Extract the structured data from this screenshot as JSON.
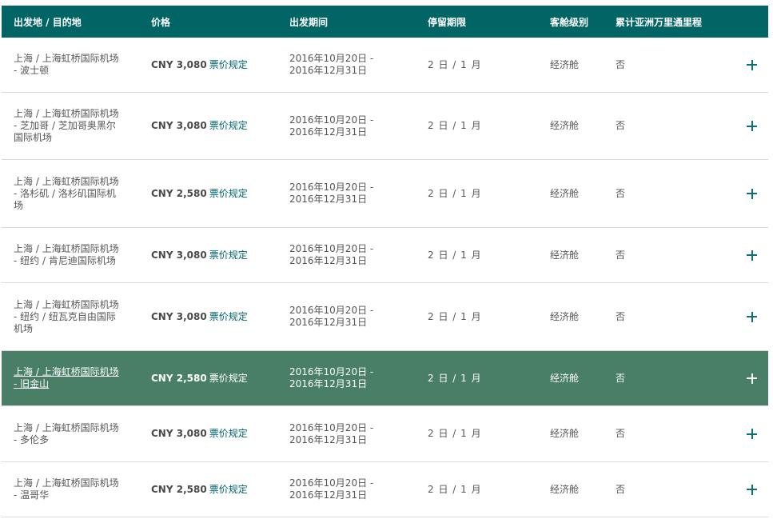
{
  "header": {
    "route": "出发地 / 目的地",
    "price": "价格",
    "dates": "出发期间",
    "stay": "停留期限",
    "cabin": "客舱级别",
    "miles": "累计亚洲万里通里程"
  },
  "rows": [
    {
      "route_lines": [
        "上海 / 上海虹桥国际机场",
        "- 波士顿"
      ],
      "price": "CNY 3,080",
      "rules_label": "票价规定",
      "dates_lines": [
        "2016年10月20日 -",
        "2016年12月31日"
      ],
      "stay": "2 日 / 1 月",
      "cabin": "经济舱",
      "miles": "否",
      "highlighted": false
    },
    {
      "route_lines": [
        "上海 / 上海虹桥国际机场",
        "- 芝加哥 / 芝加哥奥黑尔",
        "国际机场"
      ],
      "price": "CNY 3,080",
      "rules_label": "票价规定",
      "dates_lines": [
        "2016年10月20日 -",
        "2016年12月31日"
      ],
      "stay": "2 日 / 1 月",
      "cabin": "经济舱",
      "miles": "否",
      "highlighted": false
    },
    {
      "route_lines": [
        "上海 / 上海虹桥国际机场",
        "- 洛杉矶 / 洛杉矶国际机",
        "场"
      ],
      "price": "CNY 2,580",
      "rules_label": "票价规定",
      "dates_lines": [
        "2016年10月20日 -",
        "2016年12月31日"
      ],
      "stay": "2 日 / 1 月",
      "cabin": "经济舱",
      "miles": "否",
      "highlighted": false
    },
    {
      "route_lines": [
        "上海 / 上海虹桥国际机场",
        "- 纽约 / 肯尼迪国际机场"
      ],
      "price": "CNY 3,080",
      "rules_label": "票价规定",
      "dates_lines": [
        "2016年10月20日 -",
        "2016年12月31日"
      ],
      "stay": "2 日 / 1 月",
      "cabin": "经济舱",
      "miles": "否",
      "highlighted": false
    },
    {
      "route_lines": [
        "上海 / 上海虹桥国际机场",
        "- 纽约 / 纽瓦克自由国际",
        "机场"
      ],
      "price": "CNY 3,080",
      "rules_label": "票价规定",
      "dates_lines": [
        "2016年10月20日 -",
        "2016年12月31日"
      ],
      "stay": "2 日 / 1 月",
      "cabin": "经济舱",
      "miles": "否",
      "highlighted": false
    },
    {
      "route_lines": [
        "上海 / 上海虹桥国际机场",
        "- 旧金山"
      ],
      "price": "CNY 2,580",
      "rules_label": "票价规定",
      "dates_lines": [
        "2016年10月20日 -",
        "2016年12月31日"
      ],
      "stay": "2 日 / 1 月",
      "cabin": "经济舱",
      "miles": "否",
      "highlighted": true
    },
    {
      "route_lines": [
        "上海 / 上海虹桥国际机场",
        "- 多伦多"
      ],
      "price": "CNY 3,080",
      "rules_label": "票价规定",
      "dates_lines": [
        "2016年10月20日 -",
        "2016年12月31日"
      ],
      "stay": "2 日 / 1 月",
      "cabin": "经济舱",
      "miles": "否",
      "highlighted": false
    },
    {
      "route_lines": [
        "上海 / 上海虹桥国际机场",
        "- 温哥华"
      ],
      "price": "CNY 2,580",
      "rules_label": "票价规定",
      "dates_lines": [
        "2016年10月20日 -",
        "2016年12月31日"
      ],
      "stay": "2 日 / 1 月",
      "cabin": "经济舱",
      "miles": "否",
      "highlighted": false
    }
  ],
  "colors": {
    "header_bg": "#006564",
    "highlight_bg": "#497f67",
    "link": "#00646e",
    "plus_icon": "#0b6f7a"
  },
  "icons": {
    "expand": "plus-icon"
  }
}
